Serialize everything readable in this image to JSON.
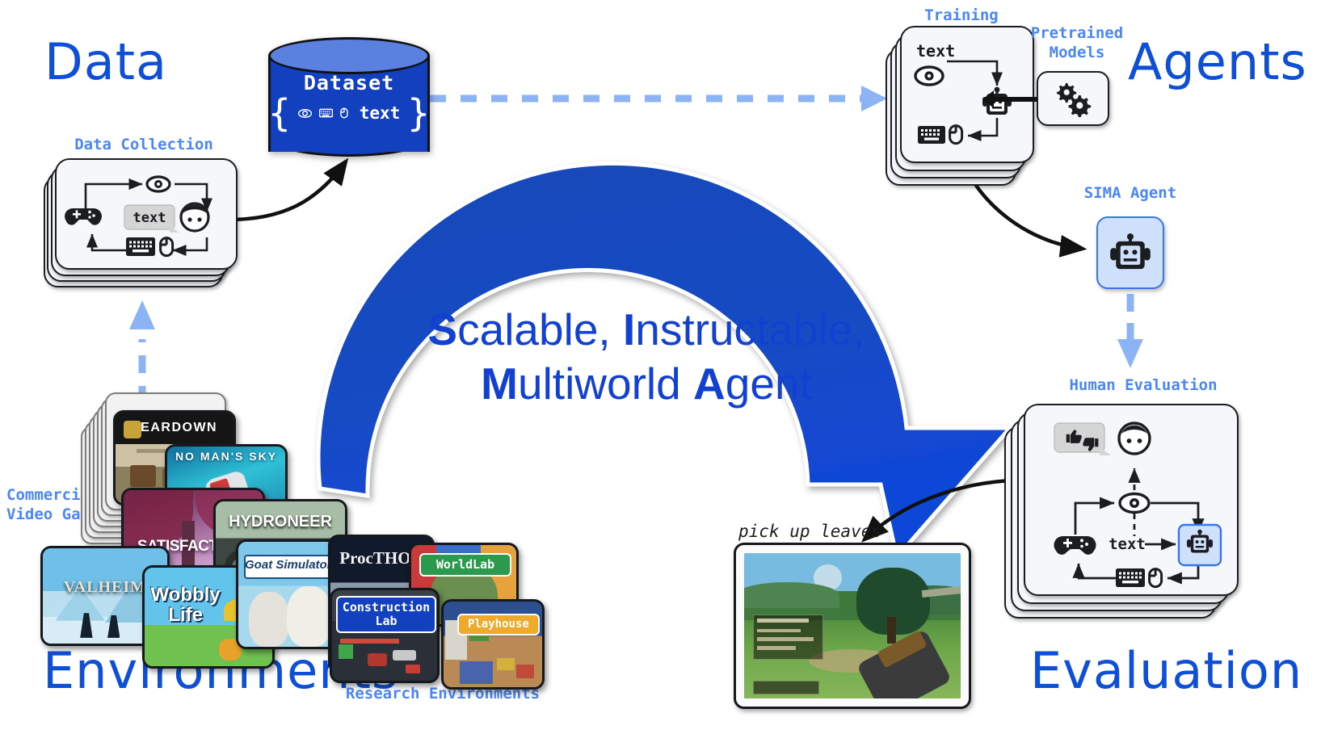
{
  "titles": {
    "data": "Data",
    "agents": "Agents",
    "environments": "Environments",
    "evaluation": "Evaluation"
  },
  "labels": {
    "data_collection": "Data Collection",
    "training": "Training",
    "pretrained_models": "Pretrained\nModels",
    "sima_agent": "SIMA Agent",
    "human_evaluation": "Human Evaluation",
    "commercial_video_games": "Commercial\nVideo Games",
    "research_environments": "Research Environments"
  },
  "dataset": {
    "title": "Dataset",
    "open_brace": "{",
    "close_brace": "}",
    "modalities": [
      "eye-icon",
      "keyboard-icon",
      "mouse-icon"
    ],
    "text_token": "text"
  },
  "training_card": {
    "text_token": "text"
  },
  "human_eval_card": {
    "text_token": "text"
  },
  "instruction": "pick up leaves",
  "center": {
    "line1_bold": "S",
    "line1_rest": "calable, ",
    "line1_bold2": "I",
    "line1_rest2": "nstructable,",
    "line2_bold": "M",
    "line2_rest": "ultiworld ",
    "line2_bold2": "A",
    "line2_rest2": "gent"
  },
  "commercial_games": [
    {
      "name": "Teardown",
      "title": "TEARDOWN"
    },
    {
      "name": "No Man's Sky",
      "title": "NO MAN'S SKY"
    },
    {
      "name": "Satisfactory",
      "title": "SATISFACTORY"
    },
    {
      "name": "Hydroneer",
      "title": "HYDRONEER"
    },
    {
      "name": "Valheim",
      "title": "VALHEIM"
    },
    {
      "name": "Wobbly Life",
      "title": "Wobbly Life"
    },
    {
      "name": "Goat Simulator 3",
      "title": "Goat Simulator 3"
    }
  ],
  "research_environments": [
    {
      "name": "ProcTHOR",
      "title": "ProcTHOR"
    },
    {
      "name": "WorldLab",
      "title": "WorldLab"
    },
    {
      "name": "Construction Lab",
      "title": "Construction\nLab"
    },
    {
      "name": "Playhouse",
      "title": "Playhouse"
    }
  ],
  "colors": {
    "deep_blue": "#1240d0",
    "arrow_blue": "#1a49b8",
    "light_blue": "#8cb4f5",
    "label_blue": "#4a87f5",
    "cylinder_body": "#1340bf",
    "cylinder_top": "#5a80e0",
    "card_bg": "#f5f7fa",
    "ink": "#1b1d21",
    "sima_fill": "#cfe0fb",
    "sima_border": "#3a76e8"
  }
}
